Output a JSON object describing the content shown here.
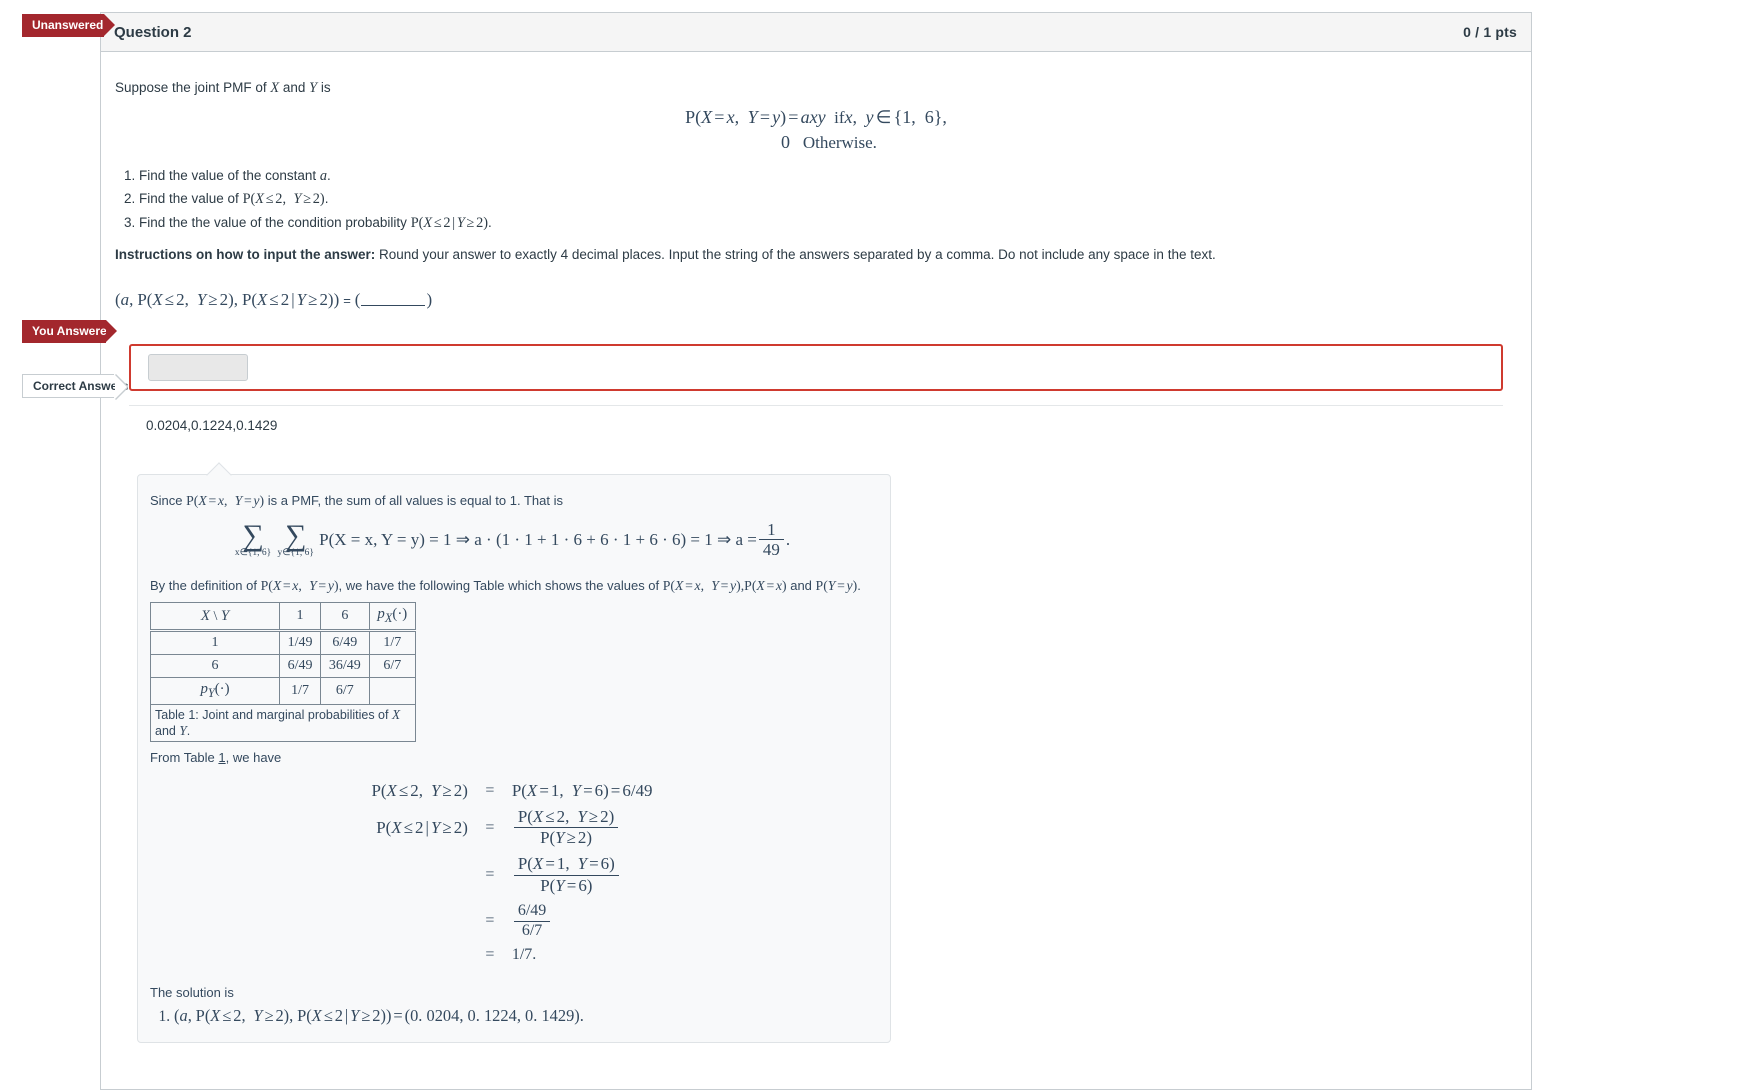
{
  "badges": {
    "unanswered": "Unanswered",
    "you_answered": "You Answered",
    "correct_answers": "Correct Answers"
  },
  "question": {
    "title": "Question 2",
    "points": "0 / 1 pts",
    "intro": "Suppose the joint PMF of X and Y is",
    "pmf_line1": "P(X = x,  Y = y) = axy   if x,  y ∈ {1,  6},",
    "pmf_line2": "0   Otherwise.",
    "tasks": [
      "Find the value of the constant a.",
      "Find the value of P(X ≤ 2,  Y ≥ 2).",
      "Find the the value of the condition probability P(X ≤ 2 | Y ≥ 2)."
    ],
    "instructions_label": "Instructions on how to input the answer:",
    "instructions_text": "Round your answer to exactly 4 decimal places. Input the string of the answers separated by a comma. Do not include any space in the text.",
    "answer_format": "(a, P(X ≤ 2,  Y ≥ 2), P(X ≤ 2 | Y ≥ 2)) = ("
  },
  "answer": {
    "student_value": "",
    "student_placeholder": "",
    "correct": "0.0204,0.1224,0.1429"
  },
  "solution": {
    "line1_pre": "Since ",
    "line1_math": "P(X = x,  Y = y)",
    "line1_post": " is a PMF, the sum of all values is equal to 1. That is",
    "sum_sub_x": "x∈{1,  6}",
    "sum_sub_y": "y∈{1,  6}",
    "sum_body": "P(X = x,  Y = y) = 1 ⇒ a · (1 · 1 + 1 · 6 + 6 · 1 + 6 · 6) = 1 ⇒ a =",
    "a_num": "1",
    "a_den": "49",
    "a_period": ".",
    "line2_pre": "By the definition of ",
    "line2_math1": "P(X = x,  Y = y)",
    "line2_mid": ", we have the following Table which shows the values of ",
    "line2_math2": "P(X = x,  Y = y), P(X = x)",
    "line2_and": " and ",
    "line2_math3": "P(Y = y)",
    "line2_end": ".",
    "table": {
      "corner": "X \\ Y",
      "columns": [
        "1",
        "6",
        "pX(·)"
      ],
      "rows": [
        {
          "label": "1",
          "cells": [
            "1/49",
            "6/49",
            "1/7"
          ]
        },
        {
          "label": "6",
          "cells": [
            "6/49",
            "36/49",
            "6/7"
          ]
        },
        {
          "label": "pY(·)",
          "cells": [
            "1/7",
            "6/7",
            ""
          ]
        }
      ],
      "caption": "Table 1: Joint and marginal probabilities of X and Y."
    },
    "from_table_pre": "From Table ",
    "from_table_ref": "1",
    "from_table_post": ", we have",
    "derivation": [
      {
        "lhs": "P(X ≤ 2,  Y ≥ 2)",
        "eq": "=",
        "rhs_type": "plain",
        "rhs": "P(X = 1,  Y = 6) = 6/49"
      },
      {
        "lhs": "P(X ≤ 2 | Y ≥ 2)",
        "eq": "=",
        "rhs_type": "frac",
        "num": "P(X ≤ 2,  Y ≥ 2)",
        "den": "P(Y ≥ 2)"
      },
      {
        "lhs": "",
        "eq": "=",
        "rhs_type": "frac",
        "num": "P(X = 1,  Y = 6)",
        "den": "P(Y = 6)"
      },
      {
        "lhs": "",
        "eq": "=",
        "rhs_type": "frac",
        "num": "6/49",
        "den": "6/7"
      },
      {
        "lhs": "",
        "eq": "=",
        "rhs_type": "plain",
        "rhs": "1/7."
      }
    ],
    "final_label": "The solution is",
    "final_item": "(a, P(X ≤ 2,  Y ≥ 2), P(X ≤ 2 | Y ≥ 2)) = (0. 0204, 0. 1224, 0. 1429)."
  },
  "colors": {
    "flag_red": "#a3272d",
    "answer_border_red": "#cf3a2f",
    "header_bg": "#f5f5f5",
    "border": "#c7cdd1",
    "text": "#2d3b45",
    "math_text": "#34495e",
    "solution_bg": "#f8f9fa"
  }
}
